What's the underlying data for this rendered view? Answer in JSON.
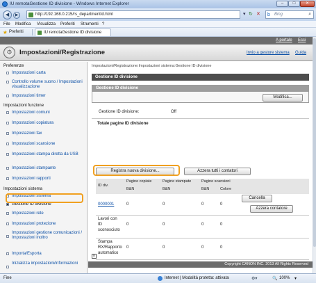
{
  "browser": {
    "window_title": "IU remotaGestione ID divisione - Windows Internet Explorer",
    "address": "http://192.168.0.215/rs_departmentId.html",
    "search_placeholder": "Bing",
    "menu": [
      "File",
      "Modifica",
      "Visualizza",
      "Preferiti",
      "Strumenti",
      "?"
    ],
    "favorites_label": "Preferiti",
    "tab_title": "IU remotaGestione ID divisione",
    "status_left": "Fine",
    "status_zone": "Internet | Modalità protetta: attivata",
    "zoom": "100%"
  },
  "app": {
    "top_links": {
      "portal": "A portale",
      "logout": "Esci"
    },
    "title": "Impostazioni/Registrazione",
    "header_links": {
      "mail": "Invio a gestore sistema",
      "guide": "Guida"
    }
  },
  "sidebar": {
    "sections": [
      {
        "title": "Preferenze",
        "items": [
          "Impostazioni carta",
          "Controllo volume suono / Impostazioni visualizzazione",
          "Impostazioni timer"
        ]
      },
      {
        "title": "Impostazioni funzione",
        "items": [
          "Impostazioni comuni",
          "Impostazioni copiatura",
          "Impostazioni fax",
          "Impostazioni scansione",
          "Impostazioni stampa diretta da USB",
          "Impostazioni stampante",
          "Impostazioni rapporti"
        ]
      },
      {
        "title": "Impostazioni sistema",
        "items": [
          "Impostazioni sistema",
          "Gestione ID divisione",
          "Impostazioni rete",
          "Impostazioni protezione",
          "Impostazioni gestione comunicazioni / Impostazioni inoltro",
          "Importa/Esporta",
          "Inizializza impostazioni/informazioni"
        ]
      }
    ]
  },
  "main": {
    "breadcrumb": "Impostazioni/Registrazione:Impostazioni sistema:Gestione ID divisione",
    "page_title": "Gestione ID divisione",
    "section_title": "Gestione ID divisione",
    "edit_button": "Modifica...",
    "status_label": "Gestione ID divisione:",
    "status_value": "Off",
    "totals_title": "Totale pagine ID divisione",
    "register_button": "Registra nuova divisione...",
    "reset_all_button": "Azzera tutti i contatori",
    "table": {
      "col_id": "ID div.",
      "group_copy": "Pagine copiate",
      "group_print": "Pagine stampate",
      "group_scan": "Pagine scansioni",
      "bw": "B&N",
      "color": "Colore",
      "rows": [
        {
          "id": "0000001",
          "copy_bw": "0",
          "print_bw": "0",
          "scan_bw": "0",
          "scan_color": "0",
          "delete_button": "Cancella",
          "reset_button": "Azzera contatore"
        },
        {
          "id": "Lavori con ID sconosciuto",
          "copy_bw": "0",
          "print_bw": "0",
          "scan_bw": "0",
          "scan_color": "0"
        },
        {
          "id": "Stampa RX/Rapporto automatico",
          "copy_bw": "0",
          "print_bw": "0",
          "scan_bw": "0",
          "scan_color": "0"
        }
      ]
    },
    "copyright": "Copyright CANON INC. 2013 All Rights Reserved"
  }
}
